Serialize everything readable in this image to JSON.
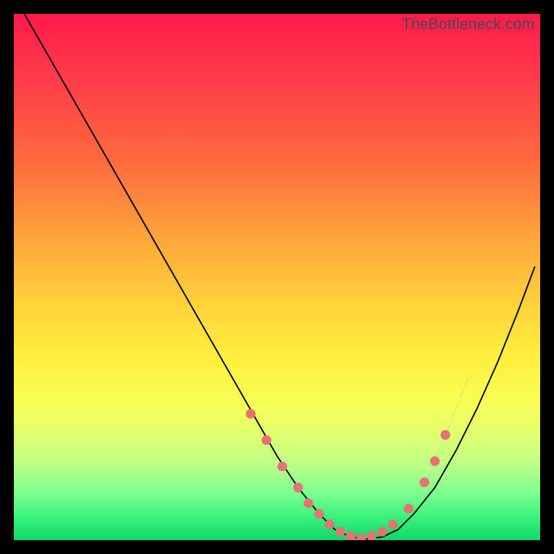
{
  "watermark": "TheBottleneck.com",
  "chart_data": {
    "type": "line",
    "title": "",
    "xlabel": "",
    "ylabel": "",
    "xlim": [
      0,
      100
    ],
    "ylim": [
      0,
      100
    ],
    "series": [
      {
        "name": "curve",
        "x": [
          2,
          6,
          10,
          14,
          18,
          22,
          26,
          30,
          34,
          38,
          42,
          46,
          50,
          54,
          58,
          61,
          64,
          67,
          70,
          73,
          76,
          80,
          84,
          88,
          92,
          96,
          99
        ],
        "y": [
          100,
          93,
          86,
          79,
          72,
          65,
          58,
          51,
          44,
          37,
          30,
          23,
          16,
          10,
          5,
          2,
          0.6,
          0.2,
          0.6,
          2,
          5,
          10,
          17,
          25,
          34,
          44,
          52
        ]
      }
    ],
    "markers": {
      "name": "highlight-dots",
      "x": [
        45,
        48,
        51,
        54,
        56,
        58,
        60,
        62,
        64,
        66,
        68,
        70,
        72,
        75,
        78,
        80,
        82
      ],
      "y": [
        24,
        19,
        14,
        10,
        7,
        5,
        3,
        1.6,
        0.8,
        0.4,
        0.8,
        1.6,
        3,
        6,
        11,
        15,
        20
      ]
    },
    "hatch_band": {
      "x_start": 78,
      "x_end": 86,
      "y_top": 30,
      "y_bottom": 10
    }
  }
}
